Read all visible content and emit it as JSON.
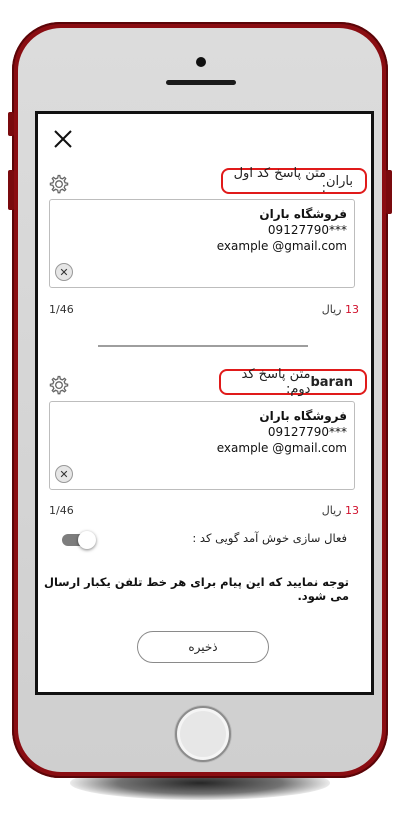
{
  "dialog": {
    "first": {
      "label_prefix": "متن پاسخ کد اول : ",
      "label_code": "باران",
      "message_lines": [
        "فروشگاه باران",
        "09127790***",
        "example @gmail.com"
      ],
      "counter": "1/46",
      "cost_number": "13",
      "cost_unit": "ریال"
    },
    "second": {
      "label_prefix": "متن پاسخ کد دوم: ",
      "label_code": "baran",
      "message_lines": [
        "فروشگاه باران",
        "09127790***",
        "example @gmail.com"
      ],
      "counter": "1/46",
      "cost_number": "13",
      "cost_unit": "ریال"
    },
    "welcome_toggle_label": "فعال سازی خوش آمد گویی کد :",
    "welcome_toggle_on": false,
    "notice": "توجه نمایید که این پیام برای هر خط تلفن یکبار ارسال می شود.",
    "save_label": "ذخیره"
  },
  "icons": {
    "close": "close-icon",
    "settings": "gear-icon",
    "clear": "clear-icon"
  },
  "colors": {
    "accent_red": "#e01a1a",
    "phone_body": "#8a0d12",
    "cost_number": "#d0102c"
  }
}
